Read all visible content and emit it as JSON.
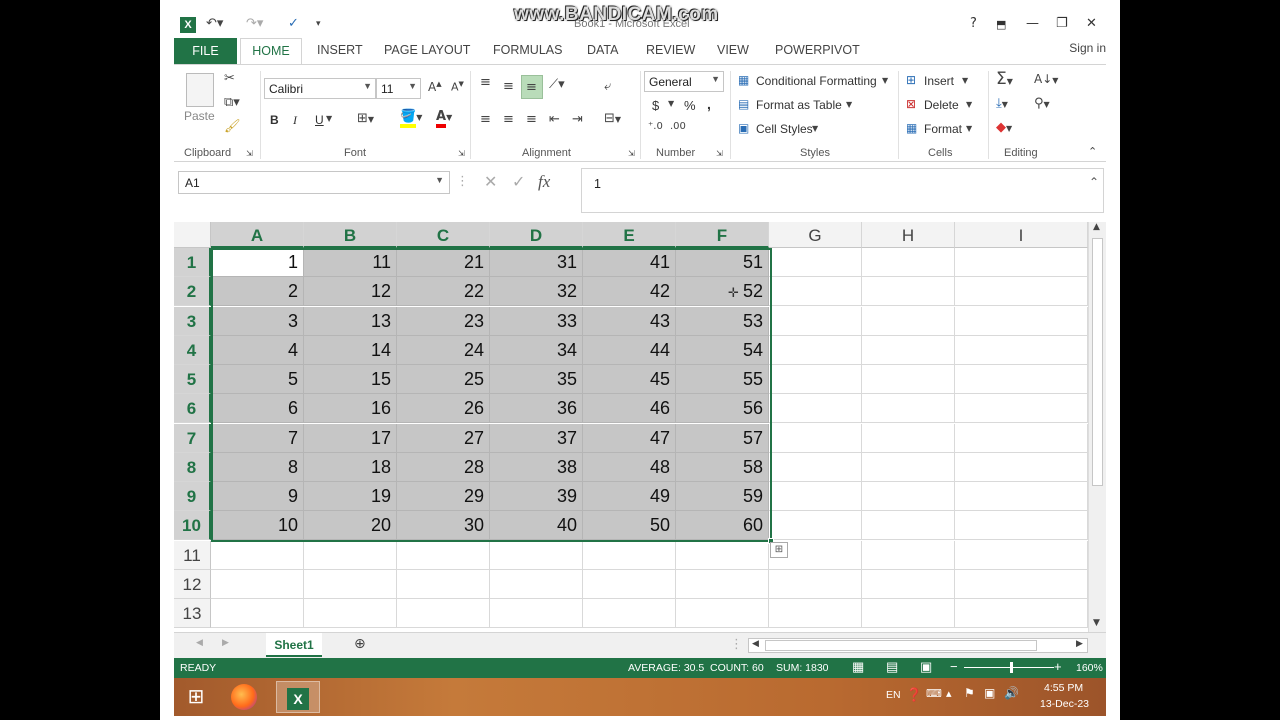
{
  "watermark": "www.BANDICAM.com",
  "window": {
    "title": "Book1 - Microsoft Excel",
    "help": "?",
    "min": "—",
    "restore": "❐",
    "close": "✕"
  },
  "tabs": [
    "FILE",
    "HOME",
    "INSERT",
    "PAGE LAYOUT",
    "FORMULAS",
    "DATA",
    "REVIEW",
    "VIEW",
    "POWERPIVOT"
  ],
  "sign_in": "Sign in",
  "ribbon": {
    "clipboard": {
      "paste": "Paste",
      "label": "Clipboard"
    },
    "font": {
      "name": "Calibri",
      "size": "11",
      "label": "Font",
      "bold": "B",
      "italic": "I",
      "underline": "U"
    },
    "alignment": {
      "label": "Alignment"
    },
    "number": {
      "format": "General",
      "label": "Number",
      "currency": "$",
      "percent": "%",
      "comma": ","
    },
    "styles": {
      "conditional": "Conditional Formatting",
      "table": "Format as Table",
      "cell": "Cell Styles",
      "label": "Styles"
    },
    "cells": {
      "insert": "Insert",
      "delete": "Delete",
      "format": "Format",
      "label": "Cells"
    },
    "editing": {
      "label": "Editing"
    }
  },
  "formula_bar": {
    "name_box": "A1",
    "fx": "fx",
    "value": "1"
  },
  "grid": {
    "columns": [
      "A",
      "B",
      "C",
      "D",
      "E",
      "F",
      "G",
      "H",
      "I"
    ],
    "rows": [
      "1",
      "2",
      "3",
      "4",
      "5",
      "6",
      "7",
      "8",
      "9",
      "10",
      "11",
      "12",
      "13"
    ],
    "selected_columns": [
      "A",
      "B",
      "C",
      "D",
      "E",
      "F"
    ],
    "selected_rows": 10,
    "values": [
      [
        "1",
        "11",
        "21",
        "31",
        "41",
        "51"
      ],
      [
        "2",
        "12",
        "22",
        "32",
        "42",
        "52"
      ],
      [
        "3",
        "13",
        "23",
        "33",
        "43",
        "53"
      ],
      [
        "4",
        "14",
        "24",
        "34",
        "44",
        "54"
      ],
      [
        "5",
        "15",
        "25",
        "35",
        "45",
        "55"
      ],
      [
        "6",
        "16",
        "26",
        "36",
        "46",
        "56"
      ],
      [
        "7",
        "17",
        "27",
        "37",
        "47",
        "57"
      ],
      [
        "8",
        "18",
        "28",
        "38",
        "48",
        "58"
      ],
      [
        "9",
        "19",
        "29",
        "39",
        "49",
        "59"
      ],
      [
        "10",
        "20",
        "30",
        "40",
        "50",
        "60"
      ]
    ]
  },
  "sheet_tab": "Sheet1",
  "status": {
    "ready": "READY",
    "average": "AVERAGE: 30.5",
    "count": "COUNT: 60",
    "sum": "SUM: 1830",
    "zoom": "160%"
  },
  "taskbar": {
    "lang": "EN",
    "time": "4:55 PM",
    "date": "13-Dec-23"
  },
  "colors": {
    "accent": "#217346",
    "selection": "#c6c6c6"
  }
}
